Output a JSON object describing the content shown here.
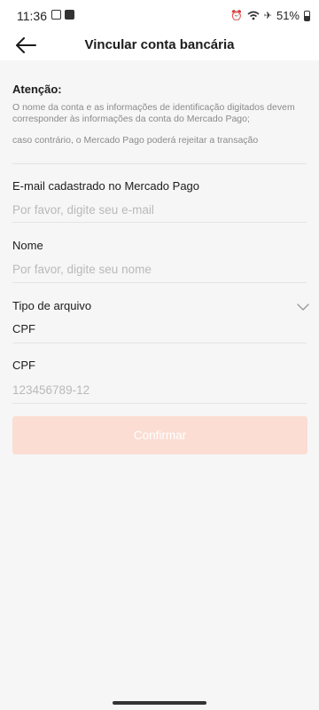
{
  "status_bar": {
    "time": "11:36",
    "battery": "51%",
    "icons": [
      "gallery-icon",
      "notification-icon",
      "alarm-icon",
      "wifi-icon",
      "airplane-icon",
      "battery-icon"
    ]
  },
  "header": {
    "title": "Vincular conta bancária",
    "back_icon": "arrow-left-icon"
  },
  "notice": {
    "title": "Atenção:",
    "line1": "O nome da conta e as informações de identificação digitados devem corresponder às informações da conta do Mercado Pago;",
    "line2": "caso contrário, o Mercado Pago poderá rejeitar a transação"
  },
  "form": {
    "email": {
      "label": "E-mail cadastrado no Mercado Pago",
      "placeholder": "Por favor, digite seu e-mail",
      "value": ""
    },
    "name": {
      "label": "Nome",
      "placeholder": "Por favor, digite seu nome",
      "value": ""
    },
    "doc_type": {
      "label": "Tipo de arquivo",
      "selected": "CPF",
      "icon": "chevron-down-icon"
    },
    "cpf": {
      "label": "CPF",
      "placeholder": "123456789-12",
      "value": ""
    }
  },
  "confirm_label": "Confirmar",
  "colors": {
    "background": "#f6f6f6",
    "confirm_disabled": "#fbddd3",
    "placeholder": "#b9b9b9"
  }
}
